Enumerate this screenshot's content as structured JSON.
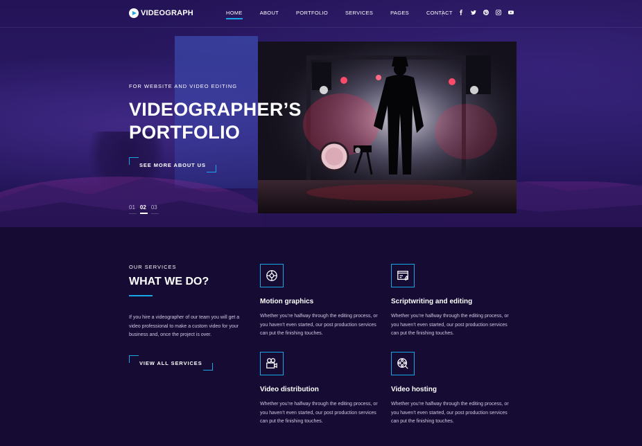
{
  "brand": {
    "name": "VIDEOGRAPH"
  },
  "nav": {
    "items": [
      {
        "label": "HOME",
        "active": true
      },
      {
        "label": "ABOUT",
        "active": false
      },
      {
        "label": "PORTFOLIO",
        "active": false
      },
      {
        "label": "SERVICES",
        "active": false
      },
      {
        "label": "PAGES",
        "active": false
      },
      {
        "label": "CONTACT",
        "active": false
      }
    ],
    "socials": [
      "facebook-icon",
      "twitter-icon",
      "pinterest-icon",
      "instagram-icon",
      "youtube-icon"
    ]
  },
  "hero": {
    "subtitle": "FOR WEBSITE AND VIDEO EDITING",
    "title_line1": "VIDEOGRAPHER’S",
    "title_line2": "PORTFOLIO",
    "cta": "SEE MORE ABOUT US",
    "pager": [
      "01",
      "02",
      "03"
    ],
    "active_slide": 2
  },
  "services": {
    "subtitle": "OUR SERVICES",
    "title": "WHAT WE DO?",
    "description": "If you hire a videographer of our team you will get a video professional to make a custom video for your business and, once the project is over.",
    "cta": "VIEW ALL SERVICES",
    "items": [
      {
        "icon": "motion-graphics-icon",
        "title": "Motion graphics",
        "text": "Whether you’re halfway through the editing process, or you haven’t even started, our post production services can put the finishing touches."
      },
      {
        "icon": "scriptwriting-icon",
        "title": "Scriptwriting and editing",
        "text": "Whether you’re halfway through the editing process, or you haven’t even started, our post production services can put the finishing touches."
      },
      {
        "icon": "video-camera-icon",
        "title": "Video distribution",
        "text": "Whether you’re halfway through the editing process, or you haven’t even started, our post production services can put the finishing touches."
      },
      {
        "icon": "film-reel-icon",
        "title": "Video hosting",
        "text": "Whether you’re halfway through the editing process, or you haven’t even started, our post production services can put the finishing touches."
      }
    ]
  },
  "colors": {
    "accent": "#1aa7e8",
    "background": "#150b33",
    "hero": "#2a1a66"
  }
}
